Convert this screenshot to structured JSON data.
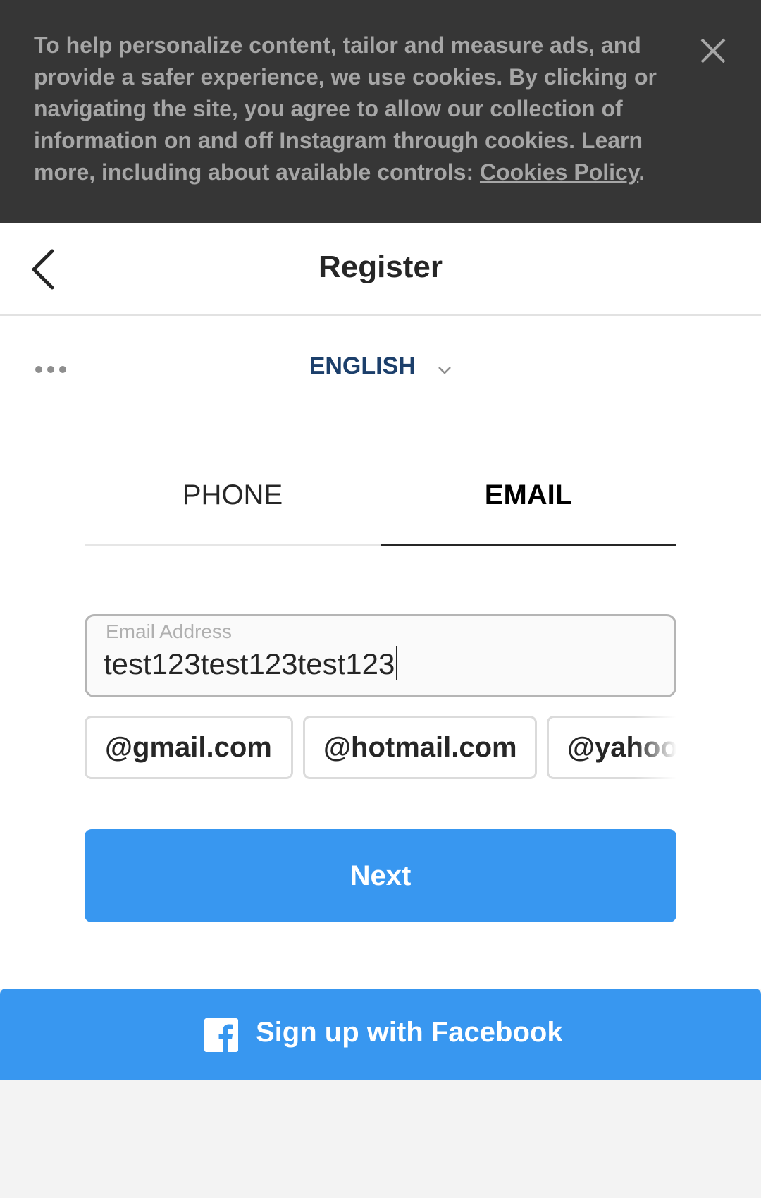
{
  "cookie_banner": {
    "text": "To help personalize content, tailor and measure ads, and provide a safer experience, we use cookies. By clicking or navigating the site, you agree to allow our collection of information on and off Instagram through cookies. Learn more, including about available controls: ",
    "link_text": "Cookies Policy",
    "trailing": ".",
    "close_icon": "close-icon"
  },
  "header": {
    "title": "Register",
    "back_icon": "chevron-left-icon"
  },
  "language": {
    "selected": "ENGLISH",
    "more_icon": "more-horizontal-icon"
  },
  "tabs": [
    {
      "label": "PHONE",
      "active": false
    },
    {
      "label": "EMAIL",
      "active": true
    }
  ],
  "email": {
    "label": "Email Address",
    "value": "test123test123test123"
  },
  "domain_suggestions": [
    "@gmail.com",
    "@hotmail.com",
    "@yahoo.com"
  ],
  "next_button": "Next",
  "facebook_button": "Sign up with Facebook",
  "colors": {
    "accent": "#3897f0",
    "banner": "#363636",
    "language": "#1c3f6b"
  }
}
